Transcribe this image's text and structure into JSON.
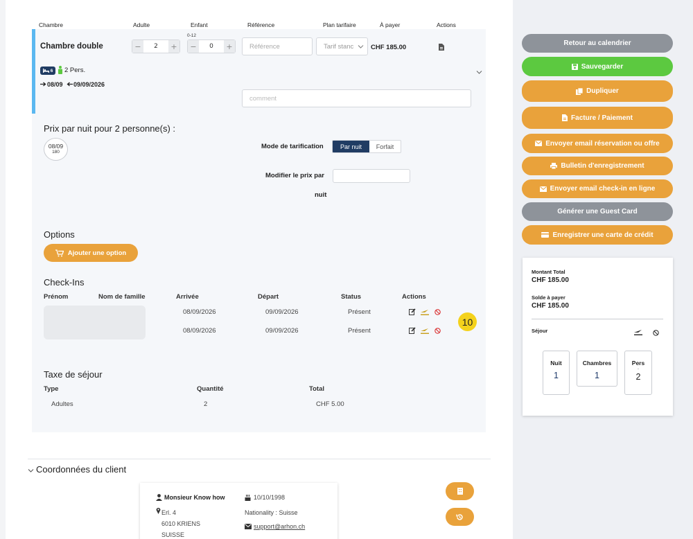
{
  "table_header": {
    "room": "Chambre",
    "adult": "Adulte",
    "child": "Enfant",
    "child_age": "0-12",
    "reference": "Référence",
    "rate_plan": "Plan tarifaire",
    "to_pay": "À payer",
    "actions": "Actions"
  },
  "room": {
    "name": "Chambre double",
    "adults": "2",
    "children": "0",
    "reference_placeholder": "Référence",
    "rate_plan": "Tarif stanc",
    "price": "CHF 185.00",
    "bed_badge": "6",
    "persons": "2 Pers.",
    "arrival": "08/09",
    "departure": "09/09/2026",
    "comment_placeholder": "comment"
  },
  "pricing": {
    "title": "Prix par nuit pour 2 personne(s) :",
    "night_date": "08/09",
    "night_price": "180",
    "mode_label": "Mode de tarification",
    "mode_per_night": "Par nuit",
    "mode_flat": "Forfait",
    "modify_label_1": "Modifier le prix par",
    "modify_label_2": "nuit"
  },
  "options": {
    "title": "Options",
    "add_button": "Ajouter une option"
  },
  "checkins": {
    "title": "Check-Ins",
    "headers": [
      "Prénom",
      "Nom de famille",
      "Arrivée",
      "Départ",
      "Status",
      "Actions"
    ],
    "rows": [
      {
        "arrival": "08/09/2026",
        "departure": "09/09/2026",
        "status": "Présent"
      },
      {
        "arrival": "08/09/2026",
        "departure": "09/09/2026",
        "status": "Présent"
      }
    ],
    "badge": "10"
  },
  "tax": {
    "title": "Taxe de séjour",
    "headers": [
      "Type",
      "Quantité",
      "Total"
    ],
    "row": {
      "type": "Adultes",
      "qty": "2",
      "total": "CHF 5.00"
    }
  },
  "client": {
    "section_title": "Coordonnées du client",
    "name": "Monsieur  Know how",
    "street": "Erl. 4",
    "city": "6010 KRIENS",
    "country": "SUISSE",
    "birthdate": "10/10/1998",
    "nationality": "Nationality : Suisse",
    "email": "support@arhon.ch"
  },
  "sidebar": {
    "buttons": [
      "Retour au calendrier",
      "Sauvegarder",
      "Dupliquer",
      "Facture / Paiement",
      "Envoyer email réservation ou offre",
      "Bulletin d'enregistrement",
      "Envoyer email check-in en ligne",
      "Générer une Guest Card",
      "Enregistrer une carte de crédit"
    ],
    "total_label": "Montant Total",
    "total_value": "CHF 185.00",
    "balance_label": "Solde à payer",
    "balance_value": "CHF 185.00",
    "stay_label": "Séjour",
    "nights_label": "Nuit",
    "nights_value": "1",
    "rooms_label": "Chambres",
    "rooms_value": "1",
    "persons_label": "Pers",
    "persons_dot": ".",
    "persons_value": "2"
  },
  "colors": {
    "accent_orange": "#e9a23b",
    "save_green": "#5cc940",
    "neutral_gray": "#8e939a",
    "navy": "#203c63",
    "room_bar_blue": "#5bb8f0"
  }
}
